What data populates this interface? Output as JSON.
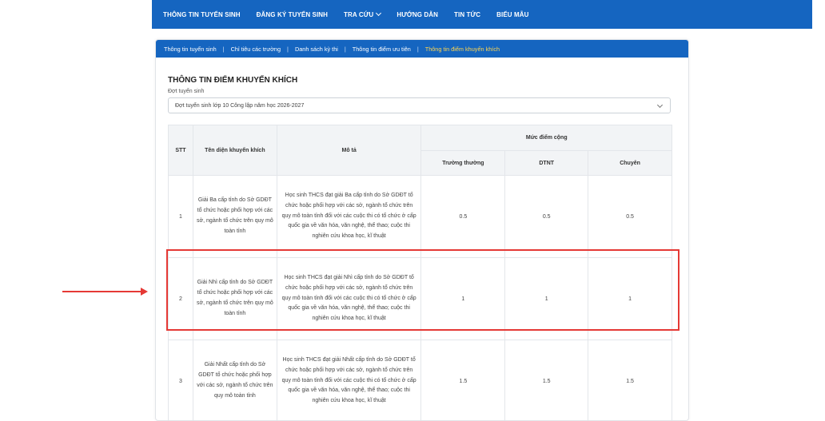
{
  "topnav": {
    "items": [
      "THÔNG TIN TUYỂN SINH",
      "ĐĂNG KÝ TUYỂN SINH",
      "TRA CỨU",
      "HƯỚNG DẪN",
      "TIN TỨC",
      "BIỂU MẪU"
    ]
  },
  "subnav": {
    "items": [
      "Thông tin tuyển sinh",
      "Chỉ tiêu các trường",
      "Danh sách kỳ thi",
      "Thông tin điểm ưu tiên",
      "Thông tin điểm khuyến khích"
    ],
    "separator": "|"
  },
  "page": {
    "title": "THÔNG TIN ĐIỂM KHUYẾN KHÍCH",
    "select_label": "Đợt tuyển sinh",
    "select_value": "Đợt tuyển sinh lớp 10 Công lập năm học 2026-2027"
  },
  "table": {
    "headers": {
      "stt": "STT",
      "name": "Tên diện khuyến khích",
      "desc": "Mô tả",
      "group": "Mức điểm cộng",
      "col1": "Trường thường",
      "col2": "DTNT",
      "col3": "Chuyên"
    },
    "rows": [
      {
        "stt": "1",
        "name": "Giải Ba cấp tỉnh do Sở GDĐT tổ chức hoặc phối hợp với các sở, ngành tổ chức trên quy mô toàn tỉnh",
        "desc": "Học sinh THCS đạt giải Ba cấp tỉnh do Sở GDĐT tổ chức hoặc phối hợp với các sở, ngành tổ chức trên quy mô toàn tỉnh đối với các cuộc thi có tổ chức ở cấp quốc gia về văn hóa, văn nghệ, thể thao; cuộc thi nghiên cứu khoa học, kĩ thuật",
        "v1": "0.5",
        "v2": "0.5",
        "v3": "0.5"
      },
      {
        "stt": "2",
        "name": "Giải Nhì cấp tỉnh do Sở GDĐT tổ chức hoặc phối hợp với các sở, ngành tổ chức trên quy mô toàn tỉnh",
        "desc": "Học sinh THCS đạt giải Nhì cấp tỉnh do Sở GDĐT tổ chức hoặc phối hợp với các sở, ngành tổ chức trên quy mô toàn tỉnh đối với các cuộc thi có tổ chức ở cấp quốc gia về văn hóa, văn nghệ, thể thao; cuộc thi nghiên cứu khoa học, kĩ thuật",
        "v1": "1",
        "v2": "1",
        "v3": "1"
      },
      {
        "stt": "3",
        "name": "Giải Nhất cấp tỉnh do Sở GDĐT tổ chức hoặc phối hợp với các sở, ngành tổ chức trên quy mô toàn tỉnh",
        "desc": "Học sinh THCS đạt giải Nhất cấp tỉnh do Sở GDĐT tổ chức hoặc phối hợp với các sở, ngành tổ chức trên quy mô toàn tỉnh đối với các cuộc thi có tổ chức ở cấp quốc gia về văn hóa, văn nghệ, thể thao; cuộc thi nghiên cứu khoa học, kĩ thuật",
        "v1": "1.5",
        "v2": "1.5",
        "v3": "1.5"
      }
    ]
  },
  "colors": {
    "brand": "#1565c0",
    "active_subnav": "#ffd54f",
    "annotation": "#e53935"
  }
}
